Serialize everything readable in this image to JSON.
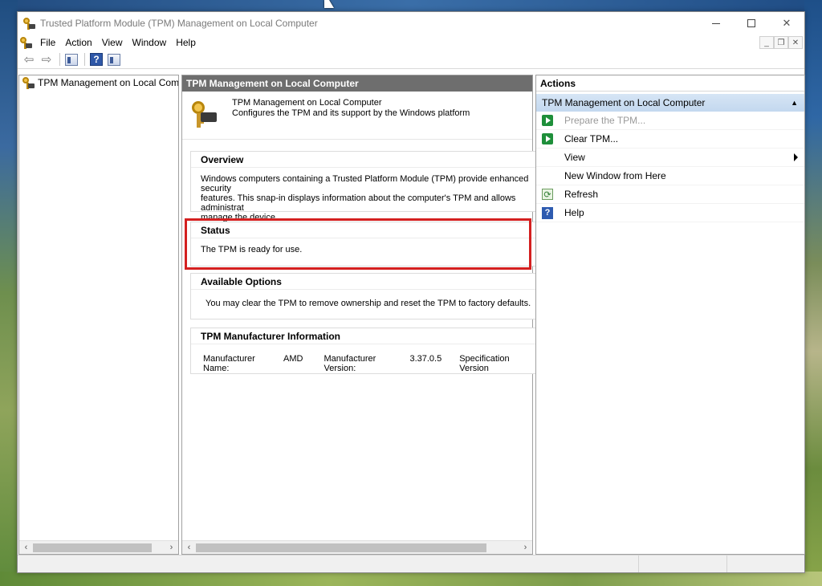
{
  "window": {
    "title": "Trusted Platform Module (TPM) Management on Local Computer"
  },
  "menubar": {
    "items": [
      "File",
      "Action",
      "View",
      "Window",
      "Help"
    ]
  },
  "toolbar": {
    "back_glyph": "⇦",
    "forward_glyph": "⇨",
    "help_glyph": "?"
  },
  "mdi": {
    "minimize": "_",
    "restore": "❐",
    "close": "✕"
  },
  "tree": {
    "item_label": "TPM Management on Local Comp"
  },
  "center": {
    "header": "TPM Management on Local Computer",
    "snapin": {
      "title": "TPM Management on Local Computer",
      "description": "Configures the TPM and its support by the Windows platform"
    },
    "overview": {
      "title": "Overview",
      "body": "Windows computers containing a Trusted Platform Module (TPM) provide enhanced security\nfeatures. This snap-in displays information about the computer's TPM and allows administrat\nmanage the device."
    },
    "status": {
      "title": "Status",
      "body": "The TPM is ready for use."
    },
    "options": {
      "title": "Available Options",
      "body": "You may clear the TPM to remove ownership and reset the TPM to factory defaults."
    },
    "manufacturer": {
      "title": "TPM Manufacturer Information",
      "name_label": "Manufacturer Name:",
      "name_value": "AMD",
      "version_label": "Manufacturer Version:",
      "version_value": "3.37.0.5",
      "spec_label": "Specification Version"
    }
  },
  "actions": {
    "header": "Actions",
    "group": "TPM Management on Local Computer",
    "items": [
      {
        "label": "Prepare the TPM...",
        "icon": "green-play-icon",
        "disabled": true
      },
      {
        "label": "Clear TPM...",
        "icon": "green-play-icon",
        "disabled": false
      },
      {
        "label": "View",
        "icon": "",
        "disabled": false,
        "submenu": true
      },
      {
        "label": "New Window from Here",
        "icon": "",
        "disabled": false
      },
      {
        "label": "Refresh",
        "icon": "refresh-icon",
        "disabled": false
      },
      {
        "label": "Help",
        "icon": "help-icon",
        "disabled": false
      }
    ]
  },
  "colors": {
    "highlight": "#d42020",
    "center_header_bg": "#6e6e6e",
    "actions_group_bg": "#c3d8ef"
  }
}
